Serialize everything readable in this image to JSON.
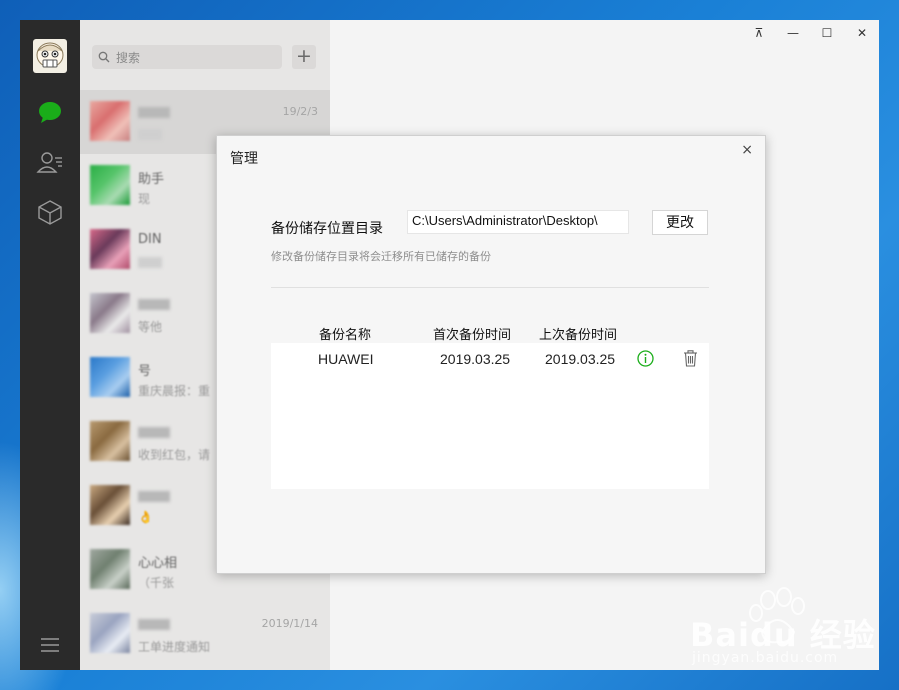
{
  "window": {
    "controls": {
      "pin": "⊼",
      "minimize": "—",
      "maximize": "☐",
      "close": "✕"
    }
  },
  "sidebar": {
    "icons": [
      "avatar",
      "chat-icon",
      "contacts-icon",
      "favorites-icon",
      "menu-icon"
    ],
    "accent": "#1aad19"
  },
  "chat_list": {
    "search_placeholder": "搜索",
    "add_label": "+",
    "items": [
      {
        "name": "",
        "message": "",
        "time": "19/2/3",
        "avatar_colors": [
          "#e8a8a0",
          "#d96f6f",
          "#f0c0b8",
          "#c88080"
        ]
      },
      {
        "name": "助手",
        "message": "现",
        "time": "",
        "avatar_colors": [
          "#2aae45",
          "#56c46a",
          "#a9dbb2",
          "#1a9a36"
        ]
      },
      {
        "name": "DIN",
        "message": "",
        "time": "",
        "avatar_colors": [
          "#d86a8a",
          "#6a3a5a",
          "#e8a0b8",
          "#b04a6a"
        ]
      },
      {
        "name": "",
        "message": "等他",
        "time": "",
        "avatar_colors": [
          "#c4c4cc",
          "#8a7a8a",
          "#eaeaea",
          "#a090a0"
        ]
      },
      {
        "name": "号",
        "message": "重庆晨报：重",
        "time": "",
        "avatar_colors": [
          "#2a78c8",
          "#5a9ee0",
          "#a8cdf0",
          "#1a5ea8"
        ]
      },
      {
        "name": "",
        "message": "收到红包，请",
        "time": "",
        "avatar_colors": [
          "#b89a70",
          "#8a6a40",
          "#d8c0a0",
          "#6a5030"
        ]
      },
      {
        "name": "",
        "message": "👌",
        "time": "",
        "avatar_colors": [
          "#c8a880",
          "#6a5038",
          "#e8d0b0",
          "#3a2a20"
        ]
      },
      {
        "name": "心心相",
        "message": "（千张",
        "time": "",
        "avatar_colors": [
          "#a0a8a0",
          "#708070",
          "#c8d0c8",
          "#586858"
        ]
      },
      {
        "name": "",
        "message": "工单进度通知",
        "time": "2019/1/14",
        "avatar_colors": [
          "#c8ccd8",
          "#9aa4c0",
          "#e8ecf4",
          "#7a84a0"
        ]
      }
    ]
  },
  "dialog": {
    "title": "管理",
    "close_label": "×",
    "path_label": "备份储存位置目录",
    "path_value": "C:\\Users\\Administrator\\Desktop\\",
    "change_button": "更改",
    "hint": "修改备份储存目录将会迁移所有已储存的备份",
    "table": {
      "headers": [
        "备份名称",
        "首次备份时间",
        "上次备份时间"
      ],
      "rows": [
        {
          "name": "HUAWEI",
          "first": "2019.03.25",
          "last": "2019.03.25"
        }
      ]
    },
    "info_color": "#1aad19"
  },
  "watermark": {
    "brand": "Baidu 经验",
    "url": "jingyan.baidu.com"
  }
}
